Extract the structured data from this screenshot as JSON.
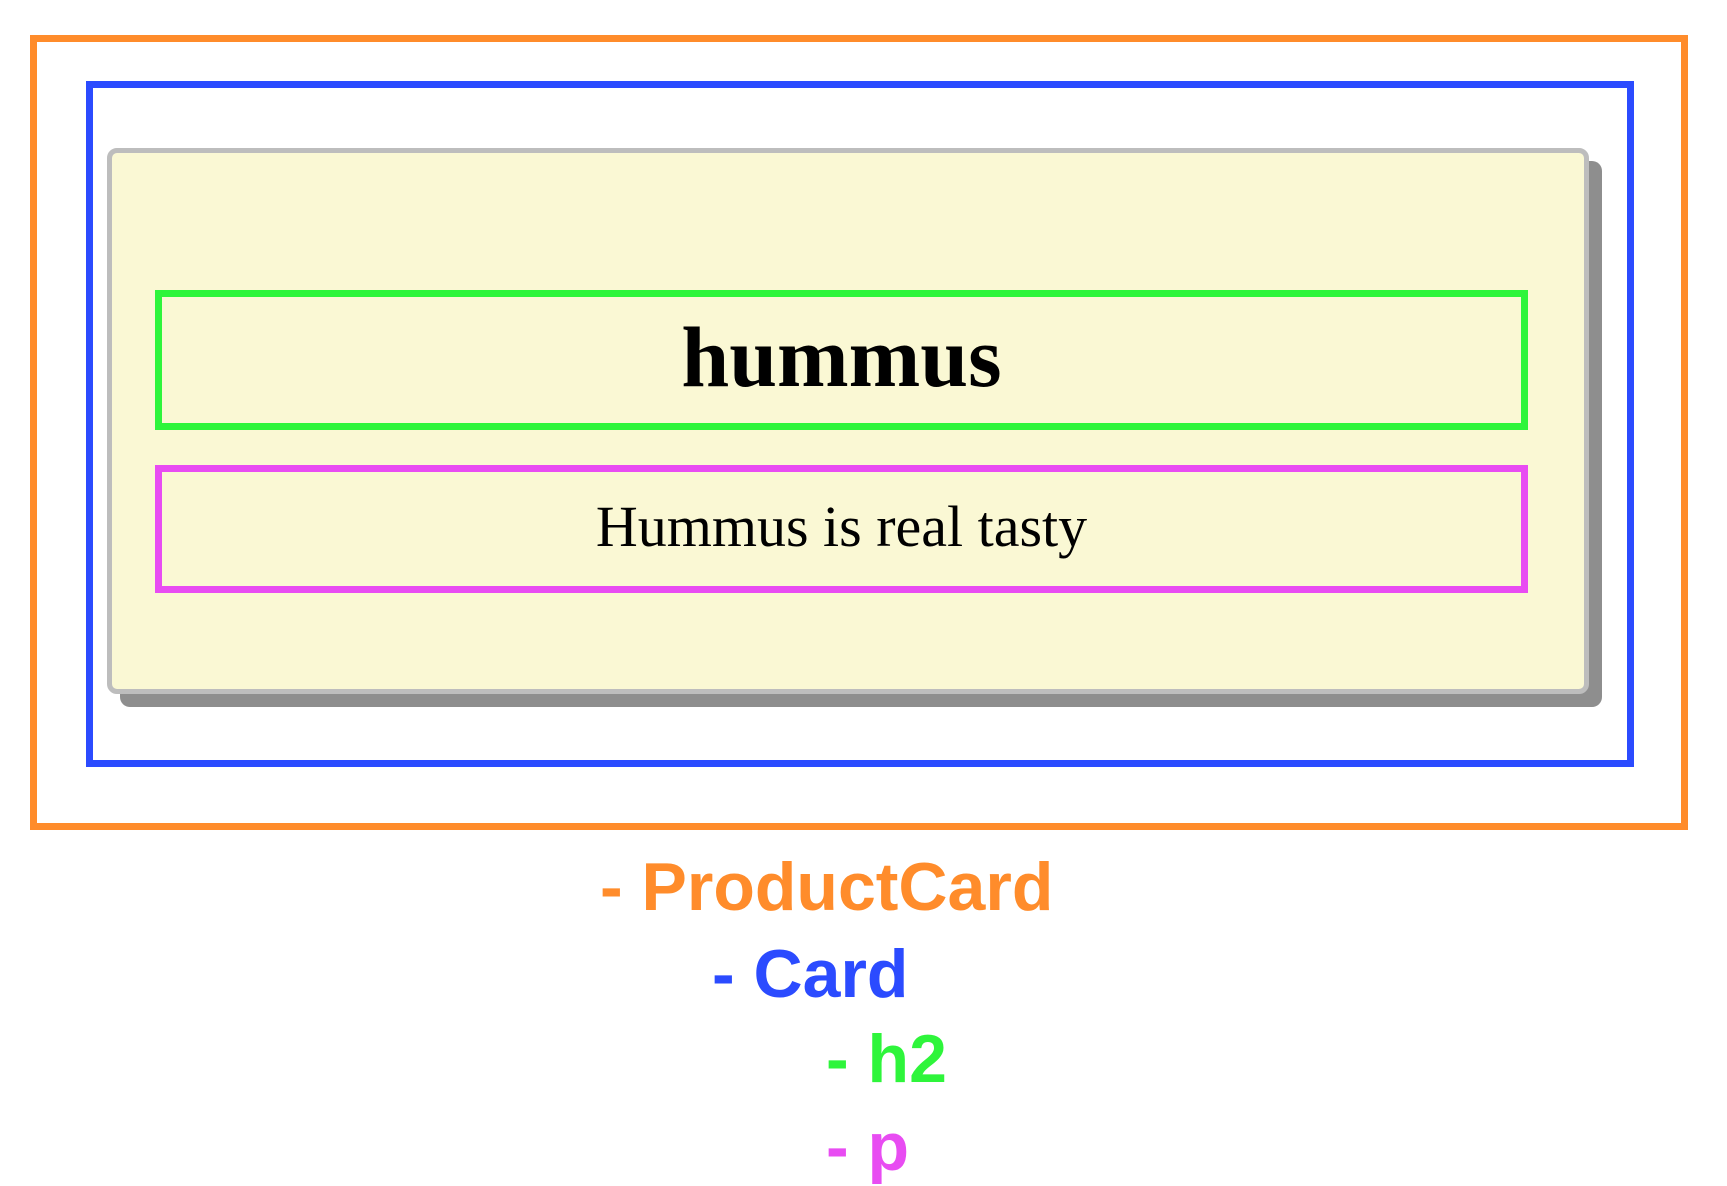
{
  "card": {
    "heading": "hummus",
    "description": "Hummus is real tasty"
  },
  "legend": [
    {
      "label": "- ProductCard",
      "color": "#FF8C2B"
    },
    {
      "label": "- Card",
      "color": "#2B4BFF"
    },
    {
      "label": "- h2",
      "color": "#2EF53B"
    },
    {
      "label": "- p",
      "color": "#E84CF2"
    }
  ],
  "colors": {
    "product_card_outline": "#FF8C2B",
    "card_outline": "#2B4BFF",
    "h2_outline": "#2EF53B",
    "p_outline": "#E84CF2",
    "card_background": "#FAF8D4",
    "card_border": "#BDBDBD",
    "card_shadow": "#8E8E8E"
  }
}
